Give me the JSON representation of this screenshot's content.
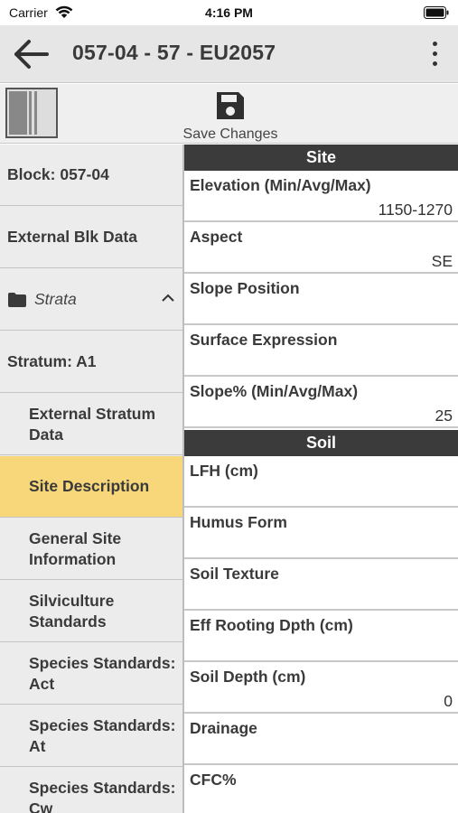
{
  "status_bar": {
    "carrier": "Carrier",
    "time": "4:16 PM"
  },
  "app_bar": {
    "title": "057-04 - 57 - EU2057"
  },
  "toolbar": {
    "save_label": "Save Changes"
  },
  "sidebar": {
    "items": [
      {
        "label": "Block: 057-04"
      },
      {
        "label": "External Blk Data"
      },
      {
        "label": "Strata"
      },
      {
        "label": "Stratum: A1"
      },
      {
        "label": "External Stratum Data"
      },
      {
        "label": "Site Description",
        "selected": true
      },
      {
        "label": "General Site Information"
      },
      {
        "label": "Silviculture Standards"
      },
      {
        "label": "Species Standards: Act"
      },
      {
        "label": "Species Standards: At"
      },
      {
        "label": "Species Standards: Cw"
      }
    ]
  },
  "content": {
    "site": {
      "header": "Site",
      "fields": [
        {
          "label": "Elevation (Min/Avg/Max)",
          "value": "1150-1270"
        },
        {
          "label": "Aspect",
          "value": "SE"
        },
        {
          "label": "Slope Position",
          "value": ""
        },
        {
          "label": "Surface Expression",
          "value": ""
        },
        {
          "label": "Slope% (Min/Avg/Max)",
          "value": "25"
        }
      ]
    },
    "soil": {
      "header": "Soil",
      "fields": [
        {
          "label": "LFH (cm)",
          "value": ""
        },
        {
          "label": "Humus Form",
          "value": ""
        },
        {
          "label": "Soil Texture",
          "value": ""
        },
        {
          "label": "Eff Rooting Dpth (cm)",
          "value": ""
        },
        {
          "label": "Soil Depth (cm)",
          "value": "0"
        },
        {
          "label": "Drainage",
          "value": ""
        },
        {
          "label": "CFC%",
          "value": ""
        }
      ]
    }
  },
  "colors": {
    "selected_item": "#f7d77a",
    "section_header": "#3b3b3b",
    "app_bar": "#e6e6e6"
  },
  "icons": [
    "wifi-icon",
    "battery-icon",
    "back-arrow-icon",
    "more-vert-icon",
    "split-panel-icon",
    "save-icon",
    "folder-icon",
    "chevron-up-icon"
  ]
}
